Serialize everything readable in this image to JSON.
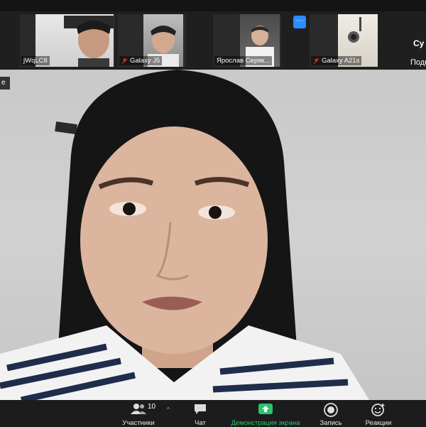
{
  "participants_strip": [
    {
      "name": "jWqLC8",
      "muted": false
    },
    {
      "name": "Galaxy J5",
      "muted": true
    },
    {
      "name": "Ярослав Серяк...",
      "muted": false
    },
    {
      "name": "Galaxy A21s",
      "muted": true
    }
  ],
  "side": {
    "line1": "Су",
    "line2": "Подк"
  },
  "more_button": "···",
  "main_tab_label": "e",
  "toolbar": {
    "participants_label": "Участники",
    "participants_count": "10",
    "chat_label": "Чат",
    "share_label": "Демонстрация экрана",
    "record_label": "Запись",
    "reactions_label": "Реакции"
  },
  "colors": {
    "accent": "#2d8cff",
    "share_green": "#2cc36b",
    "muted_red": "#e02828"
  }
}
